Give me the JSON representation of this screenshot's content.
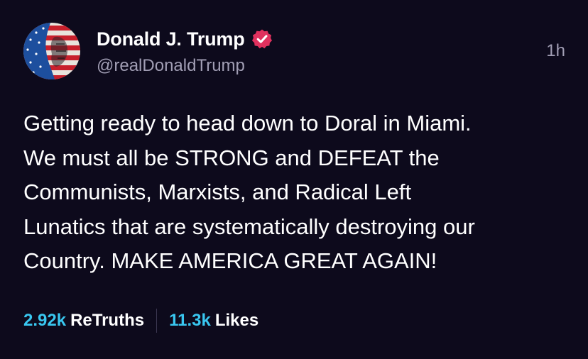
{
  "post": {
    "author": {
      "display_name": "Donald J. Trump",
      "handle": "@realDonaldTrump",
      "verified": true,
      "verified_badge_color": "#e0315e"
    },
    "timestamp": "1h",
    "text": "Getting ready to head down to Doral in Miami.\nWe must all be STRONG and DEFEAT the\nCommunists, Marxists, and Radical Left\nLunatics that are systematically destroying our\nCountry. MAKE AMERICA GREAT AGAIN!",
    "stats": {
      "retruths_count": "2.92k",
      "retruths_label": "ReTruths",
      "likes_count": "11.3k",
      "likes_label": "Likes"
    }
  },
  "colors": {
    "background": "#0d0a1c",
    "accent": "#39c7f0",
    "secondary_text": "#a19eb4"
  }
}
